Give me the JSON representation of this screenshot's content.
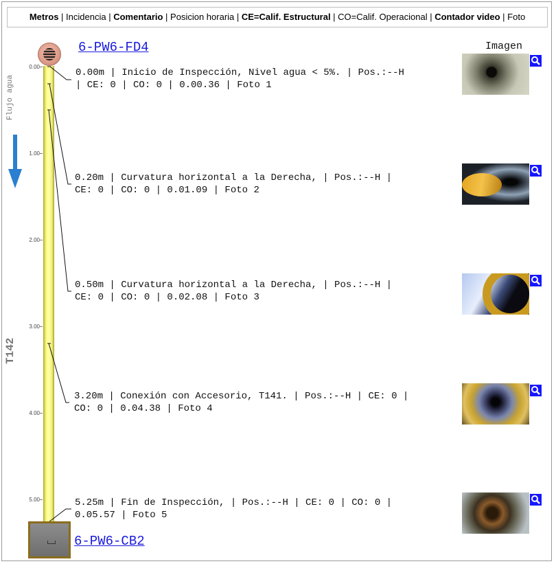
{
  "legend": {
    "metros": "Metros",
    "incidencia": "Incidencia",
    "comentario": "Comentario",
    "posicion": "Posicion horaria",
    "ce": "CE=Calif. Estructural",
    "co": "CO=Calif. Operacional",
    "contador": "Contador video",
    "foto": "Foto"
  },
  "sidebar": {
    "flujo_label": "Flujo agua",
    "tramo": "T142"
  },
  "nodes": {
    "start": "6-PW6-FD4",
    "end": "6-PW6-CB2"
  },
  "images_header": "Imagen",
  "scale": [
    "0.00",
    "1.00",
    "2.00",
    "3.00",
    "4.00",
    "5.00"
  ],
  "observations": [
    {
      "line1": "0.00m | Inicio de Inspección, Nivel agua < 5%. | Pos.:--H",
      "line2": "| CE: 0 | CO: 0 | 0.00.36 | Foto 1",
      "photo": "Foto 1"
    },
    {
      "line1": "0.20m | Curvatura horizontal a la Derecha, | Pos.:--H |",
      "line2": "CE: 0 | CO: 0 | 0.01.09 | Foto 2",
      "photo": "Foto 2"
    },
    {
      "line1": "0.50m | Curvatura horizontal a la Derecha, | Pos.:--H |",
      "line2": "CE: 0 | CO: 0 | 0.02.08 | Foto 3",
      "photo": "Foto 3"
    },
    {
      "line1": "3.20m | Conexión con Accesorio, T141. | Pos.:--H | CE: 0 |",
      "line2": "CO: 0 | 0.04.38 | Foto 4",
      "photo": "Foto 4"
    },
    {
      "line1": "5.25m | Fin de Inspección, | Pos.:--H | CE: 0 | CO: 0 |",
      "line2": "0.05.57 | Foto 5",
      "photo": "Foto 5"
    }
  ],
  "colors": {
    "link": "#1a1adc",
    "zoom": "#1616ff",
    "pipe": "#ffff8c",
    "arrow": "#2a7fd0"
  }
}
